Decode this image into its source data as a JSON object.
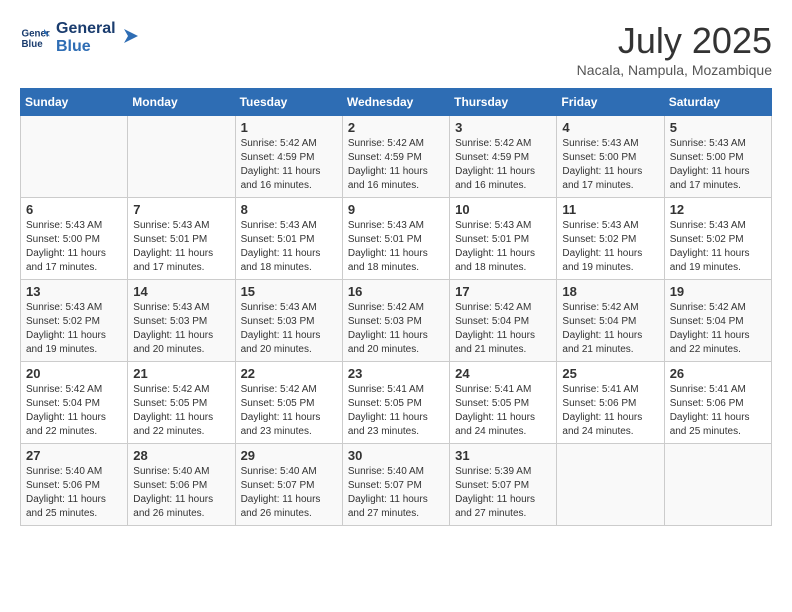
{
  "logo": {
    "line1": "General",
    "line2": "Blue"
  },
  "title": "July 2025",
  "subtitle": "Nacala, Nampula, Mozambique",
  "weekdays": [
    "Sunday",
    "Monday",
    "Tuesday",
    "Wednesday",
    "Thursday",
    "Friday",
    "Saturday"
  ],
  "weeks": [
    [
      {
        "day": "",
        "info": ""
      },
      {
        "day": "",
        "info": ""
      },
      {
        "day": "1",
        "info": "Sunrise: 5:42 AM\nSunset: 4:59 PM\nDaylight: 11 hours and 16 minutes."
      },
      {
        "day": "2",
        "info": "Sunrise: 5:42 AM\nSunset: 4:59 PM\nDaylight: 11 hours and 16 minutes."
      },
      {
        "day": "3",
        "info": "Sunrise: 5:42 AM\nSunset: 4:59 PM\nDaylight: 11 hours and 16 minutes."
      },
      {
        "day": "4",
        "info": "Sunrise: 5:43 AM\nSunset: 5:00 PM\nDaylight: 11 hours and 17 minutes."
      },
      {
        "day": "5",
        "info": "Sunrise: 5:43 AM\nSunset: 5:00 PM\nDaylight: 11 hours and 17 minutes."
      }
    ],
    [
      {
        "day": "6",
        "info": "Sunrise: 5:43 AM\nSunset: 5:00 PM\nDaylight: 11 hours and 17 minutes."
      },
      {
        "day": "7",
        "info": "Sunrise: 5:43 AM\nSunset: 5:01 PM\nDaylight: 11 hours and 17 minutes."
      },
      {
        "day": "8",
        "info": "Sunrise: 5:43 AM\nSunset: 5:01 PM\nDaylight: 11 hours and 18 minutes."
      },
      {
        "day": "9",
        "info": "Sunrise: 5:43 AM\nSunset: 5:01 PM\nDaylight: 11 hours and 18 minutes."
      },
      {
        "day": "10",
        "info": "Sunrise: 5:43 AM\nSunset: 5:01 PM\nDaylight: 11 hours and 18 minutes."
      },
      {
        "day": "11",
        "info": "Sunrise: 5:43 AM\nSunset: 5:02 PM\nDaylight: 11 hours and 19 minutes."
      },
      {
        "day": "12",
        "info": "Sunrise: 5:43 AM\nSunset: 5:02 PM\nDaylight: 11 hours and 19 minutes."
      }
    ],
    [
      {
        "day": "13",
        "info": "Sunrise: 5:43 AM\nSunset: 5:02 PM\nDaylight: 11 hours and 19 minutes."
      },
      {
        "day": "14",
        "info": "Sunrise: 5:43 AM\nSunset: 5:03 PM\nDaylight: 11 hours and 20 minutes."
      },
      {
        "day": "15",
        "info": "Sunrise: 5:43 AM\nSunset: 5:03 PM\nDaylight: 11 hours and 20 minutes."
      },
      {
        "day": "16",
        "info": "Sunrise: 5:42 AM\nSunset: 5:03 PM\nDaylight: 11 hours and 20 minutes."
      },
      {
        "day": "17",
        "info": "Sunrise: 5:42 AM\nSunset: 5:04 PM\nDaylight: 11 hours and 21 minutes."
      },
      {
        "day": "18",
        "info": "Sunrise: 5:42 AM\nSunset: 5:04 PM\nDaylight: 11 hours and 21 minutes."
      },
      {
        "day": "19",
        "info": "Sunrise: 5:42 AM\nSunset: 5:04 PM\nDaylight: 11 hours and 22 minutes."
      }
    ],
    [
      {
        "day": "20",
        "info": "Sunrise: 5:42 AM\nSunset: 5:04 PM\nDaylight: 11 hours and 22 minutes."
      },
      {
        "day": "21",
        "info": "Sunrise: 5:42 AM\nSunset: 5:05 PM\nDaylight: 11 hours and 22 minutes."
      },
      {
        "day": "22",
        "info": "Sunrise: 5:42 AM\nSunset: 5:05 PM\nDaylight: 11 hours and 23 minutes."
      },
      {
        "day": "23",
        "info": "Sunrise: 5:41 AM\nSunset: 5:05 PM\nDaylight: 11 hours and 23 minutes."
      },
      {
        "day": "24",
        "info": "Sunrise: 5:41 AM\nSunset: 5:05 PM\nDaylight: 11 hours and 24 minutes."
      },
      {
        "day": "25",
        "info": "Sunrise: 5:41 AM\nSunset: 5:06 PM\nDaylight: 11 hours and 24 minutes."
      },
      {
        "day": "26",
        "info": "Sunrise: 5:41 AM\nSunset: 5:06 PM\nDaylight: 11 hours and 25 minutes."
      }
    ],
    [
      {
        "day": "27",
        "info": "Sunrise: 5:40 AM\nSunset: 5:06 PM\nDaylight: 11 hours and 25 minutes."
      },
      {
        "day": "28",
        "info": "Sunrise: 5:40 AM\nSunset: 5:06 PM\nDaylight: 11 hours and 26 minutes."
      },
      {
        "day": "29",
        "info": "Sunrise: 5:40 AM\nSunset: 5:07 PM\nDaylight: 11 hours and 26 minutes."
      },
      {
        "day": "30",
        "info": "Sunrise: 5:40 AM\nSunset: 5:07 PM\nDaylight: 11 hours and 27 minutes."
      },
      {
        "day": "31",
        "info": "Sunrise: 5:39 AM\nSunset: 5:07 PM\nDaylight: 11 hours and 27 minutes."
      },
      {
        "day": "",
        "info": ""
      },
      {
        "day": "",
        "info": ""
      }
    ]
  ]
}
